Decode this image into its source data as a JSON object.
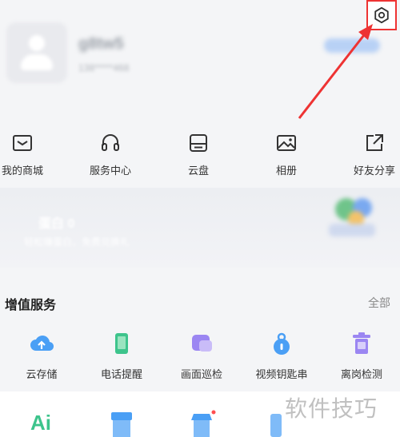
{
  "profile": {
    "name": "g8tw5",
    "subtitle": "138*****468"
  },
  "quick_actions": [
    {
      "label": "我的商城",
      "icon": "mail-icon"
    },
    {
      "label": "服务中心",
      "icon": "headset-icon"
    },
    {
      "label": "云盘",
      "icon": "cloud-drive-icon"
    },
    {
      "label": "相册",
      "icon": "photo-icon"
    },
    {
      "label": "好友分享",
      "icon": "share-icon"
    }
  ],
  "banner": {
    "title": "蛋白 0",
    "subtitle": "轻松赚蛋白，免费兑换礼"
  },
  "value_added": {
    "title": "增值服务",
    "all_label": "全部",
    "items": [
      {
        "label": "云存储",
        "icon": "cloud-upload-icon",
        "color": "#4a9ff5"
      },
      {
        "label": "电话提醒",
        "icon": "phone-icon",
        "color": "#3dc48c"
      },
      {
        "label": "画面巡检",
        "icon": "inspection-icon",
        "color": "#9b86f2"
      },
      {
        "label": "视频钥匙串",
        "icon": "key-icon",
        "color": "#4a9ff5"
      },
      {
        "label": "离岗检测",
        "icon": "trash-icon",
        "color": "#9b86f2"
      }
    ]
  },
  "watermark": "软件技巧",
  "colors": {
    "highlight": "#ee3333",
    "accent": "#4a9ff5"
  }
}
